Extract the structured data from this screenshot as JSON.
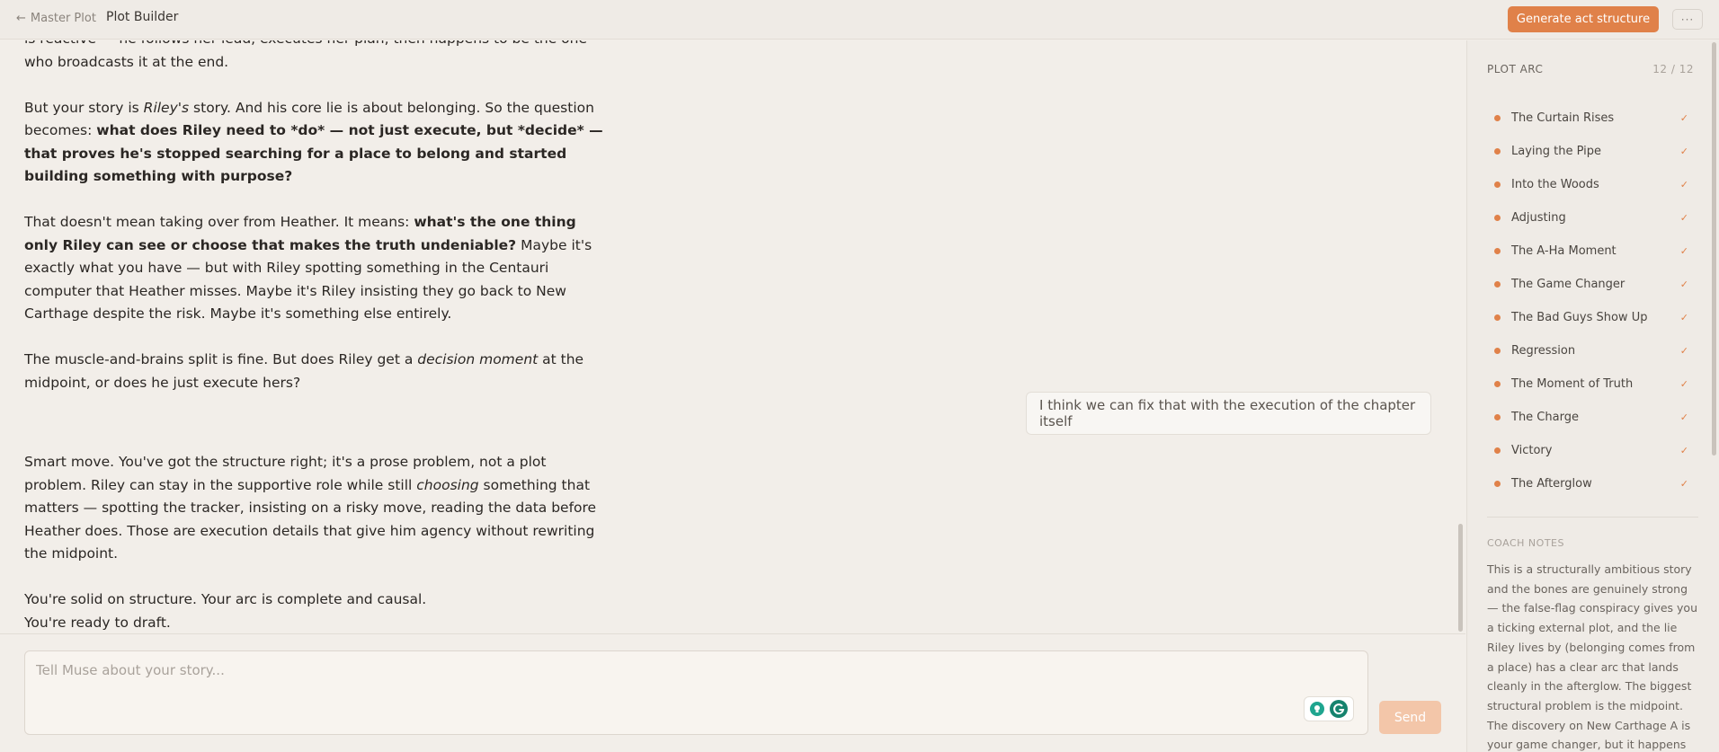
{
  "header": {
    "back_label": "Master Plot",
    "title": "Plot Builder",
    "generate_label": "Generate act structure",
    "more_label": "···"
  },
  "chat": {
    "assistant_msg_1": {
      "p1": "is reactive — he follows her lead, executes her plan, then happens to be the one who broadcasts it at the end.",
      "p2a": "But your story is ",
      "p2b": "Riley's",
      "p2c": " story. And his core lie is about belonging. So the question becomes: ",
      "p2d": "what does Riley need to *do* — not just execute, but *decide* — that proves he's stopped searching for a place to belong and started building something with purpose?",
      "p3a": "That doesn't mean taking over from Heather. It means: ",
      "p3b": "what's the one thing only Riley can see or choose that makes the truth undeniable?",
      "p3c": " Maybe it's exactly what you have — but with Riley spotting something in the Centauri computer that Heather misses. Maybe it's Riley insisting they go back to New Carthage despite the risk. Maybe it's something else entirely.",
      "p4a": "The muscle-and-brains split is fine. But does Riley get a ",
      "p4b": "decision moment",
      "p4c": " at the midpoint, or does he just execute hers?"
    },
    "user_msg": "I think we can fix that with the execution of the chapter itself",
    "assistant_msg_2": {
      "p1a": "Smart move. You've got the structure right; it's a prose problem, not a plot problem. Riley can stay in the supportive role while still ",
      "p1b": "choosing",
      "p1c": " something that matters — spotting the tracker, insisting on a risky move, reading the data before Heather does. Those are execution details that give him agency without rewriting the midpoint.",
      "p2a": "You're solid on structure. Your arc is complete and causal.",
      "p2b": "You're ready to draft."
    }
  },
  "composer": {
    "placeholder": "Tell Muse about your story...",
    "send_label": "Send"
  },
  "sidebar": {
    "arc_title": "PLOT ARC",
    "arc_count": "12 / 12",
    "arc_items": [
      {
        "label": "The Curtain Rises"
      },
      {
        "label": "Laying the Pipe"
      },
      {
        "label": "Into the Woods"
      },
      {
        "label": "Adjusting"
      },
      {
        "label": "The A-Ha Moment"
      },
      {
        "label": "The Game Changer"
      },
      {
        "label": "The Bad Guys Show Up"
      },
      {
        "label": "Regression"
      },
      {
        "label": "The Moment of Truth"
      },
      {
        "label": "The Charge"
      },
      {
        "label": "Victory"
      },
      {
        "label": "The Afterglow"
      }
    ],
    "notes_title": "COACH NOTES",
    "notes_body": "This is a structurally ambitious story and the bones are genuinely strong — the false-flag conspiracy gives you a ticking external plot, and the lie Riley lives by (belonging comes from a place) has a clear arc that lands cleanly in the afterglow. The biggest structural problem is the midpoint. The discovery on New Carthage A is your game changer, but it happens"
  },
  "colors": {
    "accent": "#e08149",
    "background": "#f2eee9"
  }
}
